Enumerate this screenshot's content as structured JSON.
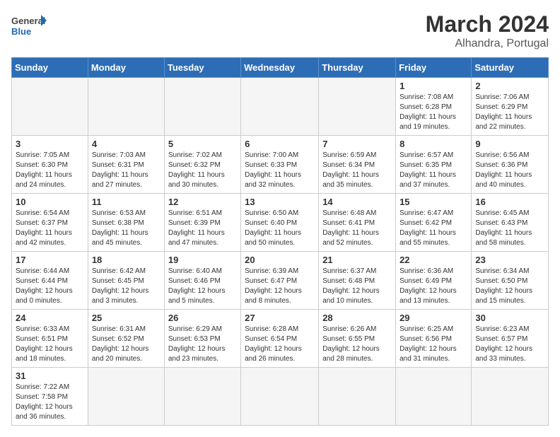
{
  "header": {
    "logo_general": "General",
    "logo_blue": "Blue",
    "month_year": "March 2024",
    "location": "Alhandra, Portugal"
  },
  "days_of_week": [
    "Sunday",
    "Monday",
    "Tuesday",
    "Wednesday",
    "Thursday",
    "Friday",
    "Saturday"
  ],
  "weeks": [
    [
      {
        "day": "",
        "info": ""
      },
      {
        "day": "",
        "info": ""
      },
      {
        "day": "",
        "info": ""
      },
      {
        "day": "",
        "info": ""
      },
      {
        "day": "",
        "info": ""
      },
      {
        "day": "1",
        "info": "Sunrise: 7:08 AM\nSunset: 6:28 PM\nDaylight: 11 hours and 19 minutes."
      },
      {
        "day": "2",
        "info": "Sunrise: 7:06 AM\nSunset: 6:29 PM\nDaylight: 11 hours and 22 minutes."
      }
    ],
    [
      {
        "day": "3",
        "info": "Sunrise: 7:05 AM\nSunset: 6:30 PM\nDaylight: 11 hours and 24 minutes."
      },
      {
        "day": "4",
        "info": "Sunrise: 7:03 AM\nSunset: 6:31 PM\nDaylight: 11 hours and 27 minutes."
      },
      {
        "day": "5",
        "info": "Sunrise: 7:02 AM\nSunset: 6:32 PM\nDaylight: 11 hours and 30 minutes."
      },
      {
        "day": "6",
        "info": "Sunrise: 7:00 AM\nSunset: 6:33 PM\nDaylight: 11 hours and 32 minutes."
      },
      {
        "day": "7",
        "info": "Sunrise: 6:59 AM\nSunset: 6:34 PM\nDaylight: 11 hours and 35 minutes."
      },
      {
        "day": "8",
        "info": "Sunrise: 6:57 AM\nSunset: 6:35 PM\nDaylight: 11 hours and 37 minutes."
      },
      {
        "day": "9",
        "info": "Sunrise: 6:56 AM\nSunset: 6:36 PM\nDaylight: 11 hours and 40 minutes."
      }
    ],
    [
      {
        "day": "10",
        "info": "Sunrise: 6:54 AM\nSunset: 6:37 PM\nDaylight: 11 hours and 42 minutes."
      },
      {
        "day": "11",
        "info": "Sunrise: 6:53 AM\nSunset: 6:38 PM\nDaylight: 11 hours and 45 minutes."
      },
      {
        "day": "12",
        "info": "Sunrise: 6:51 AM\nSunset: 6:39 PM\nDaylight: 11 hours and 47 minutes."
      },
      {
        "day": "13",
        "info": "Sunrise: 6:50 AM\nSunset: 6:40 PM\nDaylight: 11 hours and 50 minutes."
      },
      {
        "day": "14",
        "info": "Sunrise: 6:48 AM\nSunset: 6:41 PM\nDaylight: 11 hours and 52 minutes."
      },
      {
        "day": "15",
        "info": "Sunrise: 6:47 AM\nSunset: 6:42 PM\nDaylight: 11 hours and 55 minutes."
      },
      {
        "day": "16",
        "info": "Sunrise: 6:45 AM\nSunset: 6:43 PM\nDaylight: 11 hours and 58 minutes."
      }
    ],
    [
      {
        "day": "17",
        "info": "Sunrise: 6:44 AM\nSunset: 6:44 PM\nDaylight: 12 hours and 0 minutes."
      },
      {
        "day": "18",
        "info": "Sunrise: 6:42 AM\nSunset: 6:45 PM\nDaylight: 12 hours and 3 minutes."
      },
      {
        "day": "19",
        "info": "Sunrise: 6:40 AM\nSunset: 6:46 PM\nDaylight: 12 hours and 5 minutes."
      },
      {
        "day": "20",
        "info": "Sunrise: 6:39 AM\nSunset: 6:47 PM\nDaylight: 12 hours and 8 minutes."
      },
      {
        "day": "21",
        "info": "Sunrise: 6:37 AM\nSunset: 6:48 PM\nDaylight: 12 hours and 10 minutes."
      },
      {
        "day": "22",
        "info": "Sunrise: 6:36 AM\nSunset: 6:49 PM\nDaylight: 12 hours and 13 minutes."
      },
      {
        "day": "23",
        "info": "Sunrise: 6:34 AM\nSunset: 6:50 PM\nDaylight: 12 hours and 15 minutes."
      }
    ],
    [
      {
        "day": "24",
        "info": "Sunrise: 6:33 AM\nSunset: 6:51 PM\nDaylight: 12 hours and 18 minutes."
      },
      {
        "day": "25",
        "info": "Sunrise: 6:31 AM\nSunset: 6:52 PM\nDaylight: 12 hours and 20 minutes."
      },
      {
        "day": "26",
        "info": "Sunrise: 6:29 AM\nSunset: 6:53 PM\nDaylight: 12 hours and 23 minutes."
      },
      {
        "day": "27",
        "info": "Sunrise: 6:28 AM\nSunset: 6:54 PM\nDaylight: 12 hours and 26 minutes."
      },
      {
        "day": "28",
        "info": "Sunrise: 6:26 AM\nSunset: 6:55 PM\nDaylight: 12 hours and 28 minutes."
      },
      {
        "day": "29",
        "info": "Sunrise: 6:25 AM\nSunset: 6:56 PM\nDaylight: 12 hours and 31 minutes."
      },
      {
        "day": "30",
        "info": "Sunrise: 6:23 AM\nSunset: 6:57 PM\nDaylight: 12 hours and 33 minutes."
      }
    ],
    [
      {
        "day": "31",
        "info": "Sunrise: 7:22 AM\nSunset: 7:58 PM\nDaylight: 12 hours and 36 minutes."
      },
      {
        "day": "",
        "info": ""
      },
      {
        "day": "",
        "info": ""
      },
      {
        "day": "",
        "info": ""
      },
      {
        "day": "",
        "info": ""
      },
      {
        "day": "",
        "info": ""
      },
      {
        "day": "",
        "info": ""
      }
    ]
  ]
}
